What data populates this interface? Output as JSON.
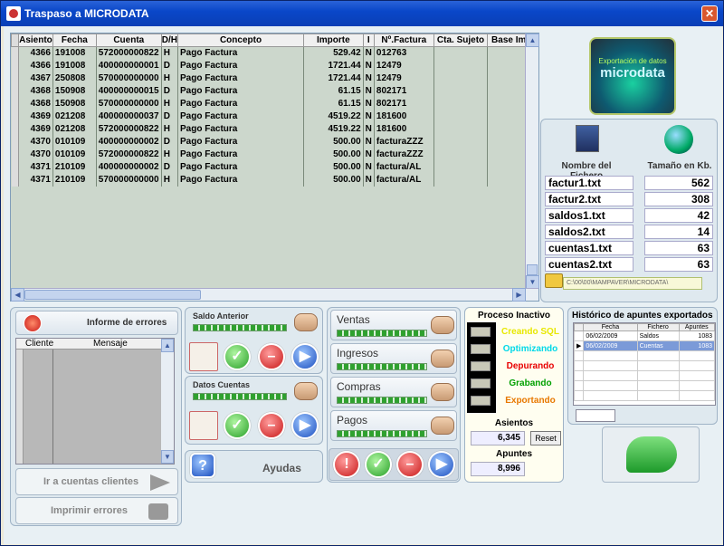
{
  "window": {
    "title": "Traspaso a MICRODATA",
    "close": "✕"
  },
  "grid": {
    "columns": [
      "Asiento",
      "Fecha",
      "Cuenta",
      "D/H",
      "Concepto",
      "Importe",
      "I",
      "Nº.Factura",
      "Cta. Sujeto",
      "Base Imp."
    ],
    "rows": [
      [
        "4366",
        "191008",
        "572000000822",
        "H",
        "Pago Factura",
        "529.42",
        "N",
        "012763",
        "",
        ""
      ],
      [
        "4366",
        "191008",
        "400000000001",
        "D",
        "Pago Factura",
        "1721.44",
        "N",
        "12479",
        "",
        ""
      ],
      [
        "4367",
        "250808",
        "570000000000",
        "H",
        "Pago Factura",
        "1721.44",
        "N",
        "12479",
        "",
        ""
      ],
      [
        "4368",
        "150908",
        "400000000015",
        "D",
        "Pago Factura",
        "61.15",
        "N",
        "802171",
        "",
        ""
      ],
      [
        "4368",
        "150908",
        "570000000000",
        "H",
        "Pago Factura",
        "61.15",
        "N",
        "802171",
        "",
        ""
      ],
      [
        "4369",
        "021208",
        "400000000037",
        "D",
        "Pago Factura",
        "4519.22",
        "N",
        "181600",
        "",
        ""
      ],
      [
        "4369",
        "021208",
        "572000000822",
        "H",
        "Pago Factura",
        "4519.22",
        "N",
        "181600",
        "",
        ""
      ],
      [
        "4370",
        "010109",
        "400000000002",
        "D",
        "Pago Factura",
        "500.00",
        "N",
        "facturaZZZ",
        "",
        ""
      ],
      [
        "4370",
        "010109",
        "572000000822",
        "H",
        "Pago Factura",
        "500.00",
        "N",
        "facturaZZZ",
        "",
        ""
      ],
      [
        "4371",
        "210109",
        "400000000002",
        "D",
        "Pago Factura",
        "500.00",
        "N",
        "factura/AL",
        "",
        ""
      ],
      [
        "4371",
        "210109",
        "570000000000",
        "H",
        "Pago Factura",
        "500.00",
        "N",
        "factura/AL",
        "",
        ""
      ]
    ]
  },
  "logo": {
    "line1": "Exportación de datos",
    "line2": "microdata"
  },
  "files": {
    "header_name": "Nombre del Fichero",
    "header_size": "Tamaño en Kb.",
    "items": [
      {
        "name": "factur1.txt",
        "size": "562"
      },
      {
        "name": "factur2.txt",
        "size": "308"
      },
      {
        "name": "saldos1.txt",
        "size": "42"
      },
      {
        "name": "saldos2.txt",
        "size": "14"
      },
      {
        "name": "cuentas1.txt",
        "size": "63"
      },
      {
        "name": "cuentas2.txt",
        "size": "63"
      }
    ],
    "path": "C:\\00\\00\\MAMPAVER\\MICRODATA\\"
  },
  "errors": {
    "button": "Informe de errores",
    "col_client": "Cliente",
    "col_message": "Mensaje",
    "goto": "Ir a cuentas clientes",
    "print": "Imprimir errores"
  },
  "middle": {
    "saldo": "Saldo Anterior",
    "datos": "Datos Cuentas",
    "help": "Ayudas",
    "help_icon": "?"
  },
  "sections": {
    "ventas": "Ventas",
    "ingresos": "Ingresos",
    "compras": "Compras",
    "pagos": "Pagos"
  },
  "process": {
    "title": "Proceso Inactivo",
    "steps": [
      {
        "label": "Creando SQL",
        "color": "#e8e800"
      },
      {
        "label": "Optimizando",
        "color": "#00d8e8"
      },
      {
        "label": "Depurando",
        "color": "#e80000"
      },
      {
        "label": "Grabando",
        "color": "#00a000"
      },
      {
        "label": "Exportando",
        "color": "#e87800"
      }
    ],
    "asientos_label": "Asientos",
    "asientos_value": "6,345",
    "reset": "Reset",
    "apuntes_label": "Apuntes",
    "apuntes_value": "8,996"
  },
  "history": {
    "title": "Histórico de apuntes exportados",
    "columns": [
      "Fecha",
      "Fichero",
      "Apuntes"
    ],
    "rows": [
      {
        "fecha": "06/02/2009",
        "fichero": "Saldos",
        "apuntes": "1083"
      },
      {
        "fecha": "06/02/2009",
        "fichero": "Cuentas",
        "apuntes": "1083"
      }
    ]
  }
}
